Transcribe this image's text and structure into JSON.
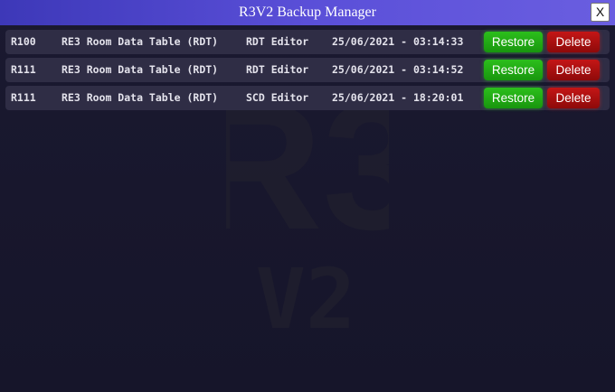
{
  "window": {
    "title": "R3V2 Backup Manager",
    "close_label": "X"
  },
  "watermark": {
    "logo_text": "R3",
    "logo_subtext": "V2"
  },
  "backups": [
    {
      "room": "R100",
      "file_type": "RE3 Room Data Table (RDT)",
      "editor": "RDT Editor",
      "timestamp": "25/06/2021 - 03:14:33",
      "restore_label": "Restore",
      "delete_label": "Delete"
    },
    {
      "room": "R111",
      "file_type": "RE3 Room Data Table (RDT)",
      "editor": "RDT Editor",
      "timestamp": "25/06/2021 - 03:14:52",
      "restore_label": "Restore",
      "delete_label": "Delete"
    },
    {
      "room": "R111",
      "file_type": "RE3 Room Data Table (RDT)",
      "editor": "SCD Editor",
      "timestamp": "25/06/2021 - 18:20:01",
      "restore_label": "Restore",
      "delete_label": "Delete"
    }
  ],
  "colors": {
    "titlebar_start": "#3d38b8",
    "titlebar_end": "#6a5ee0",
    "background": "#18172a",
    "row_background": "#2f2d45",
    "restore_button": "#1fae14",
    "delete_button": "#b31212"
  }
}
